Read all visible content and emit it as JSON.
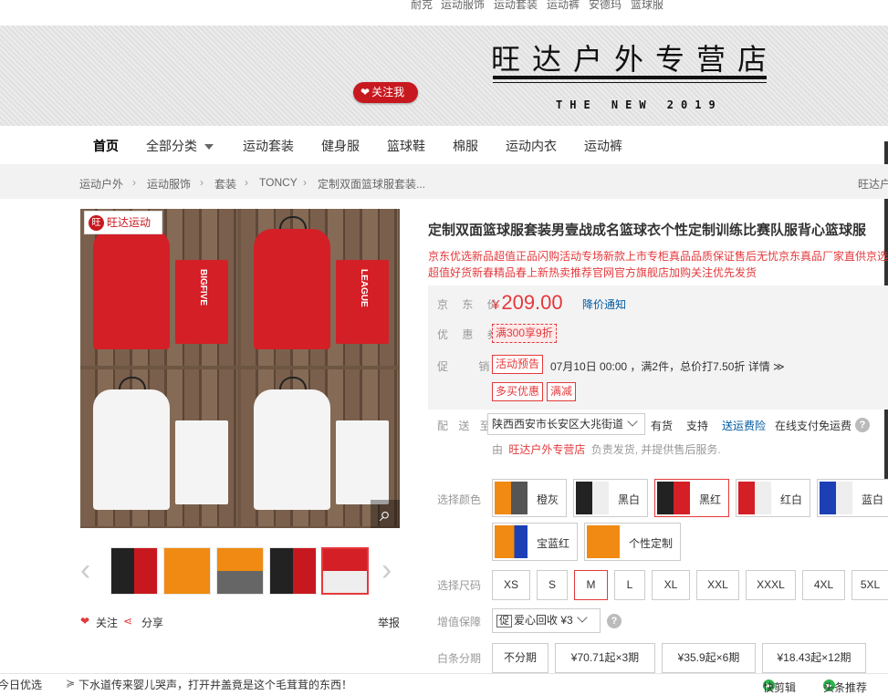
{
  "top_strip": [
    "耐克",
    "运动服饰",
    "运动套装",
    "运动裤",
    "安德玛",
    "篮球服"
  ],
  "banner": {
    "shop_name": "旺达户外专营店",
    "tagline": "THE NEW 2019",
    "follow_label": "关注我"
  },
  "nav": {
    "items": [
      "首页",
      "全部分类",
      "运动套装",
      "健身服",
      "篮球鞋",
      "棉服",
      "运动内衣",
      "运动裤"
    ]
  },
  "breadcrumb": {
    "items": [
      "运动户外",
      "运动服饰",
      "套装",
      "TONCY",
      "定制双面篮球服套装..."
    ],
    "right": "旺达户"
  },
  "gallery": {
    "brand": "旺达运动",
    "brand_logo": "旺",
    "zoom_icon": "magnifier-icon",
    "shorts_text_1": "BIGFIVE",
    "shorts_text_2": "LEAGUE",
    "actions": {
      "follow": "关注",
      "share": "分享",
      "report": "举报"
    }
  },
  "product": {
    "title": "定制双面篮球服套装男壹战成名篮球衣个性定制训练比赛队服背心篮球服",
    "description": "京东优选新品超值正品闪购活动专场新款上市专柜真品品质保证售后无忧京东真品厂家直供京选超值好货新春精品春上新热卖推荐官网官方旗舰店加购关注优先发货",
    "price_label": "京 东 价",
    "currency": "¥",
    "price": "209.00",
    "price_notice": "降价通知",
    "coupon_label": "优 惠 券",
    "coupon": "满300享9折",
    "promo_label": "促　 销",
    "promo_tag": "活动预告",
    "promo_text": "07月10日 00:00 ，满2件，总价打7.50折 详情 ≫",
    "promo_tag2": "多买优惠",
    "promo_tag3": "满减",
    "delivery_label": "配 送 至",
    "delivery_location": "陕西西安市长安区大兆街道",
    "stock": "有货",
    "support": "支持",
    "shipping_insurance": "送运费险",
    "pay_note": "在线支付免运费",
    "seller_prefix": "由",
    "seller": "旺达户外专营店",
    "seller_suffix": "负责发货, 并提供售后服务.",
    "color_label": "选择颜色",
    "colors": [
      "橙灰",
      "黑白",
      "黑红",
      "红白",
      "蓝白",
      "宝蓝红",
      "个性定制"
    ],
    "size_label": "选择尺码",
    "sizes": [
      "XS",
      "S",
      "M",
      "L",
      "XL",
      "XXL",
      "XXXL",
      "4XL",
      "5XL"
    ],
    "warranty_label": "增值保障",
    "warranty_value": "爱心回收 ¥3",
    "installment_label": "白条分期",
    "installments": [
      "不分期",
      "¥70.71起×3期",
      "¥35.9起×6期",
      "¥18.43起×12期"
    ]
  },
  "bottom_bar": {
    "left": "今日优选",
    "news": "下水道传来婴儿哭声，打开井盖竟是这个毛茸茸的东西！",
    "right1": "快剪辑",
    "right2": "头条推荐"
  },
  "colors": {
    "accent": "#e4393c",
    "follow": "#c8181f",
    "jersey_red": "#d41f27"
  }
}
